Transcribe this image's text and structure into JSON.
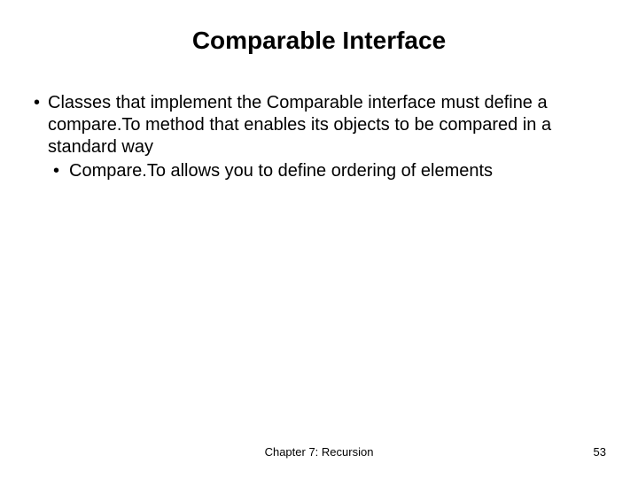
{
  "slide": {
    "title": "Comparable Interface",
    "bullets": [
      {
        "text": "Classes that implement the Comparable interface must define a compare.To method that enables its objects to be compared in a standard way",
        "children": [
          {
            "text": "Compare.To allows you to define ordering of elements"
          }
        ]
      }
    ],
    "footer": {
      "center": "Chapter 7: Recursion",
      "page": "53"
    }
  }
}
